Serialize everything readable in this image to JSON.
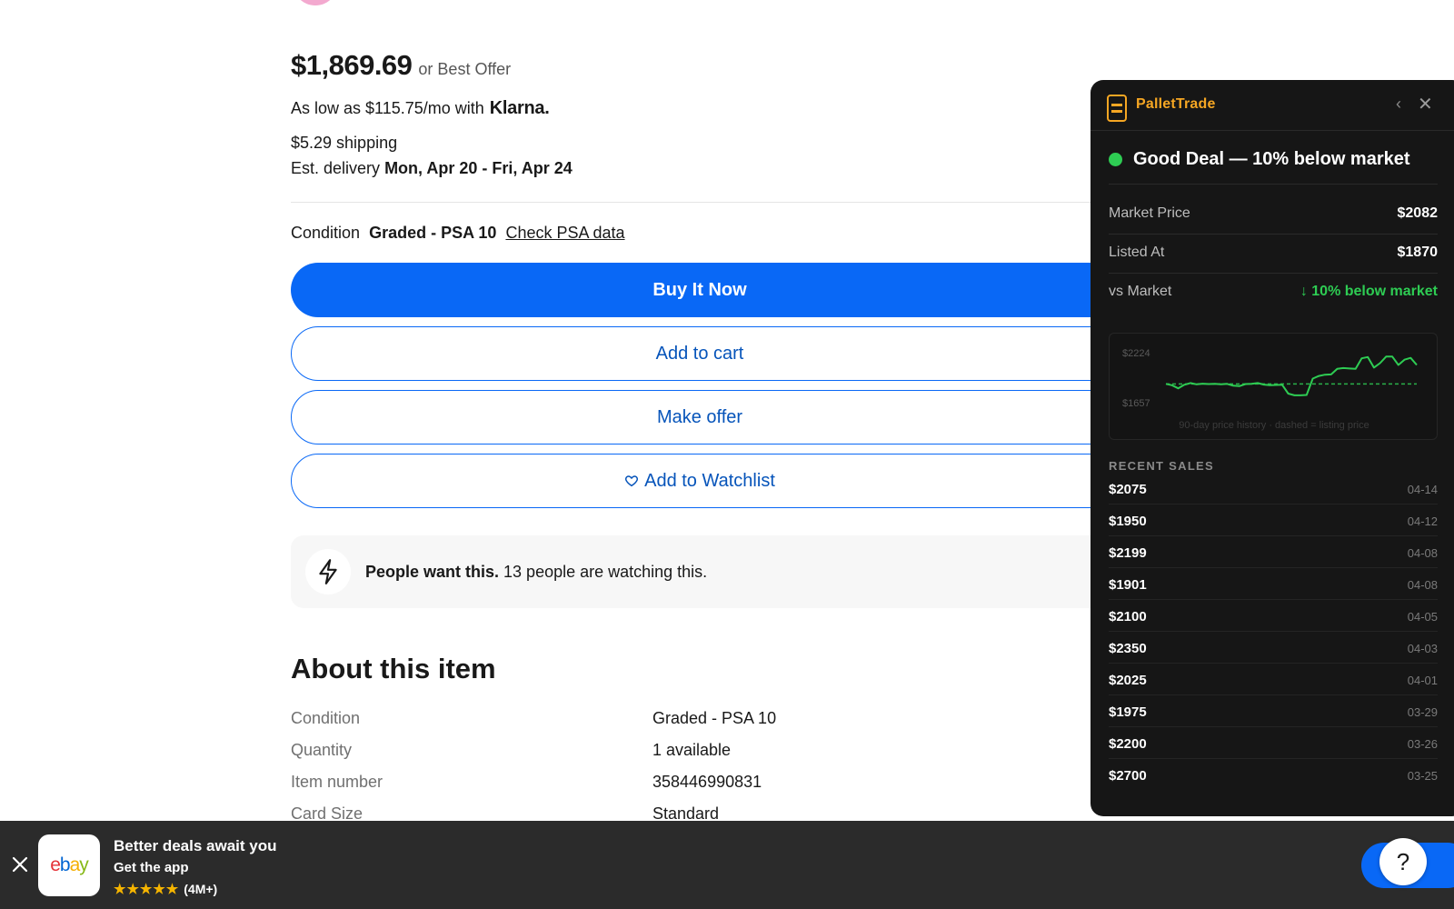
{
  "listing": {
    "price": "$1,869.69",
    "best_offer": "or Best Offer",
    "klarna_prefix": "As low as $115.75/mo with",
    "klarna_brand": "Klarna.",
    "shipping": "$5.29 shipping",
    "delivery_label": "Est. delivery",
    "delivery_range": "Mon, Apr 20 - Fri, Apr 24",
    "condition_label": "Condition",
    "condition_value": "Graded - PSA 10",
    "psa_link": "Check PSA data",
    "buttons": {
      "buy_now": "Buy It Now",
      "add_to_cart": "Add to cart",
      "make_offer": "Make offer",
      "watchlist": "Add to Watchlist"
    },
    "signal": {
      "bold": "People want this.",
      "text": " 13 people are watching this."
    },
    "about_title": "About this item",
    "specs": [
      {
        "label": "Condition",
        "value": "Graded - PSA 10"
      },
      {
        "label": "Quantity",
        "value": "1 available"
      },
      {
        "label": "Item number",
        "value": "358446990831"
      },
      {
        "label": "Card Size",
        "value": "Standard"
      }
    ]
  },
  "pallet_trade": {
    "name": "PalletTrade",
    "prev_icon": "‹",
    "close_icon": "✕",
    "verdict": "Good Deal — 10% below market",
    "verdict_color": "#2ecc53",
    "accent_color": "#f5a623",
    "metrics": [
      {
        "label": "Market Price",
        "value": "$2082",
        "tone": "white"
      },
      {
        "label": "Listed At",
        "value": "$1870",
        "tone": "white"
      },
      {
        "label": "vs Market",
        "value": "↓ 10% below market",
        "tone": "green"
      }
    ],
    "chart_caption": "90-day price history · dashed = listing price",
    "recent_sales_title": "RECENT SALES",
    "recent_sales": [
      {
        "price": "$2075",
        "date": "04-14"
      },
      {
        "price": "$1950",
        "date": "04-12"
      },
      {
        "price": "$2199",
        "date": "04-08"
      },
      {
        "price": "$1901",
        "date": "04-08"
      },
      {
        "price": "$2100",
        "date": "04-05"
      },
      {
        "price": "$2350",
        "date": "04-03"
      },
      {
        "price": "$2025",
        "date": "04-01"
      },
      {
        "price": "$1975",
        "date": "03-29"
      },
      {
        "price": "$2200",
        "date": "03-26"
      },
      {
        "price": "$2700",
        "date": "03-25"
      }
    ]
  },
  "chart_data": {
    "type": "line",
    "title": "",
    "xlabel": "",
    "ylabel": "",
    "y_tick_labels": [
      "$2224",
      "$1657"
    ],
    "ylim": [
      1657,
      2224
    ],
    "reference_line": 1870,
    "line_color": "#2ecc53",
    "grid": false,
    "values": [
      1870,
      1855,
      1820,
      1860,
      1880,
      1865,
      1872,
      1868,
      1870,
      1865,
      1870,
      1850,
      1845,
      1868,
      1870,
      1880,
      1862,
      1855,
      1858,
      1860,
      1760,
      1740,
      1740,
      1745,
      1930,
      1960,
      1975,
      1978,
      2040,
      2050,
      2045,
      2040,
      2160,
      2175,
      2055,
      2105,
      2180,
      2180,
      2085,
      2145,
      2165,
      2085
    ]
  },
  "app_banner": {
    "title": "Better deals await you",
    "subtitle": "Get the app",
    "rating": "(4M+)",
    "stars": "★★★★★",
    "help": "?"
  }
}
